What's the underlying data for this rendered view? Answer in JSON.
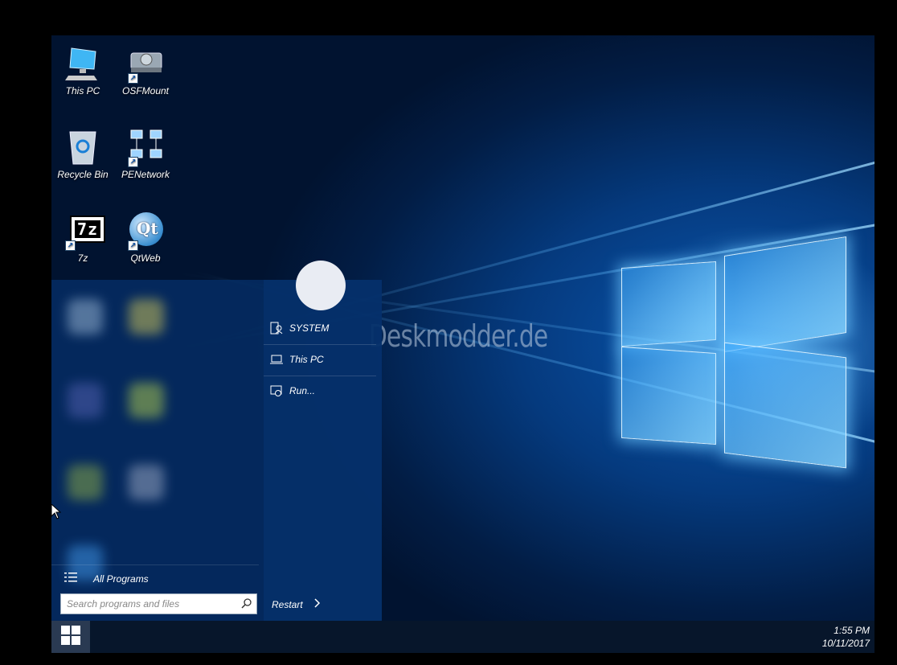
{
  "desktop": {
    "icons": [
      {
        "label": "This PC",
        "icon": "computer-icon"
      },
      {
        "label": "OSFMount",
        "icon": "drive-icon"
      },
      {
        "label": "Recycle Bin",
        "icon": "recycle-bin-icon"
      },
      {
        "label": "PENetwork",
        "icon": "network-icon"
      },
      {
        "label": "7z",
        "icon": "7zip-icon",
        "glyph": "7z"
      },
      {
        "label": "QtWeb",
        "icon": "qtweb-icon",
        "glyph": "Qt"
      }
    ],
    "watermark": "Deskmodder.de"
  },
  "start_menu": {
    "right_items": [
      {
        "label": "SYSTEM",
        "icon": "user-icon"
      },
      {
        "label": "This PC",
        "icon": "laptop-icon"
      },
      {
        "label": "Run...",
        "icon": "run-icon"
      }
    ],
    "all_programs_label": "All Programs",
    "search_placeholder": "Search programs and files",
    "restart_label": "Restart"
  },
  "taskbar": {
    "time": "1:55 PM",
    "date": "10/11/2017"
  },
  "colors": {
    "desktop_blue": "#053a7e",
    "taskbar": "#07162b",
    "start_menu": "#052d64"
  }
}
